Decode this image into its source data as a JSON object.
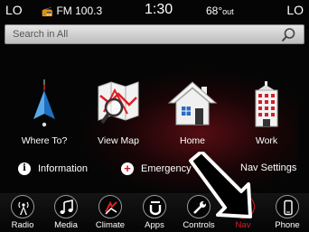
{
  "status_bar": {
    "left_label": "LO",
    "radio_station": "FM 100.3",
    "time": "1:30",
    "temperature": "68°",
    "temperature_suffix": "out",
    "right_label": "LO"
  },
  "search": {
    "placeholder": "Search in All"
  },
  "tiles": [
    {
      "label": "Where To?",
      "icon": "navigation-arrow-icon"
    },
    {
      "label": "View Map",
      "icon": "map-magnifier-icon"
    },
    {
      "label": "Home",
      "icon": "house-icon"
    },
    {
      "label": "Work",
      "icon": "office-building-icon"
    }
  ],
  "secondary": {
    "information": "Information",
    "emergency": "Emergency",
    "nav_settings": "Nav Settings"
  },
  "dock": [
    {
      "label": "Radio",
      "icon": "radio-tower-icon"
    },
    {
      "label": "Media",
      "icon": "music-note-icon"
    },
    {
      "label": "Climate",
      "icon": "climate-icon"
    },
    {
      "label": "Apps",
      "icon": "uconnect-apps-icon"
    },
    {
      "label": "Controls",
      "icon": "wrench-icon"
    },
    {
      "label": "Nav",
      "icon": "compass-icon",
      "active": true
    },
    {
      "label": "Phone",
      "icon": "phone-icon"
    }
  ],
  "colors": {
    "accent_red": "#e01b24",
    "background": "#050505",
    "search_bar": "#d6d6d6"
  }
}
